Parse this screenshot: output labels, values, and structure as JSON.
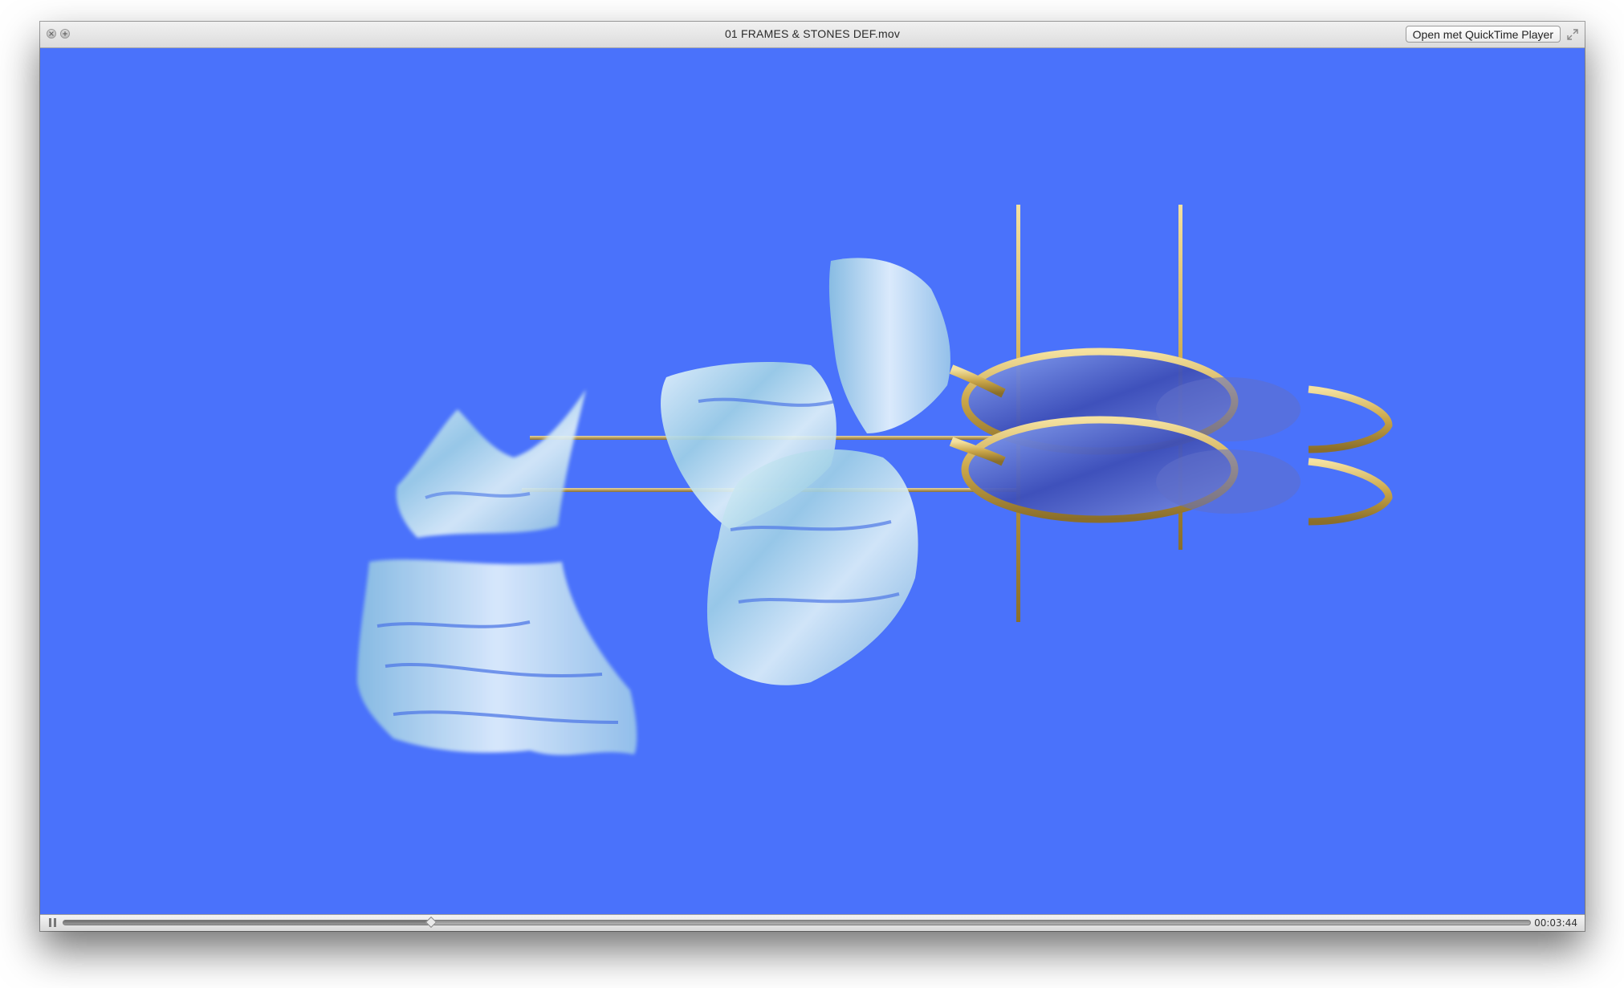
{
  "window": {
    "title": "01 FRAMES & STONES DEF.mov",
    "open_button_label": "Open met QuickTime Player"
  },
  "player": {
    "state": "playing",
    "elapsed_time": "00:03:44",
    "progress_fraction": 0.25
  },
  "colors": {
    "video_background": "#4a72fb",
    "titlebar": "#e6e6e6",
    "accent_gold": "#c9a548",
    "glass": "#bfe2ee"
  },
  "icons": {
    "close": "close-icon",
    "minimize": "minimize-icon",
    "fullscreen": "fullscreen-icon",
    "pause": "pause-icon"
  }
}
